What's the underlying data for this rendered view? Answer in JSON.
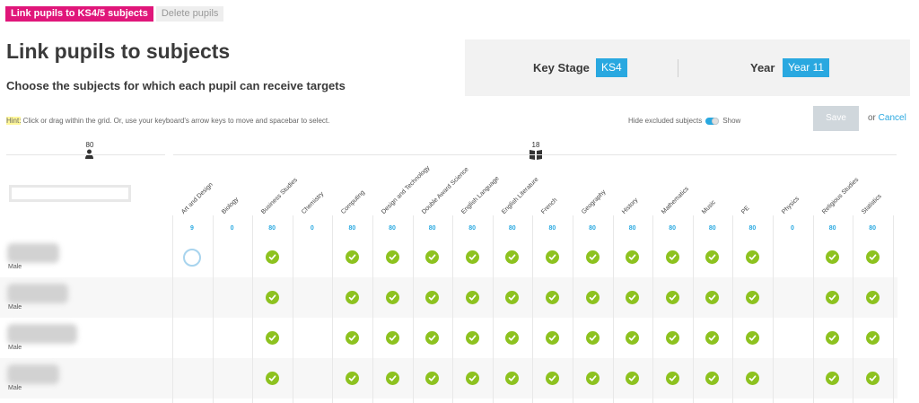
{
  "tabs": [
    {
      "label": "Link pupils to KS4/5 subjects",
      "active": true
    },
    {
      "label": "Delete pupils",
      "active": false
    }
  ],
  "title": "Link pupils to subjects",
  "subtitle": "Choose the subjects for which each pupil can receive targets",
  "context": {
    "key_stage_label": "Key Stage",
    "key_stage_value": "KS4",
    "year_label": "Year",
    "year_value": "Year 11"
  },
  "hint": {
    "tag": "Hint:",
    "text": " Click or drag within the grid. Or, use your keyboard's arrow keys to move and spacebar to select."
  },
  "toggle": {
    "left_label": "Hide excluded subjects",
    "right_label": "Show"
  },
  "actions": {
    "save_label": "Save",
    "or_label": "or ",
    "cancel_label": "Cancel"
  },
  "counts": {
    "pupils": "80",
    "subjects": "18"
  },
  "search": {
    "placeholder": ""
  },
  "colors": {
    "accent": "#29a8e0",
    "tab_active": "#e0167a",
    "check": "#8dc21f"
  },
  "subjects": [
    {
      "name": "Art and Design",
      "count": "9"
    },
    {
      "name": "Biology",
      "count": "0"
    },
    {
      "name": "Business Studies",
      "count": "80"
    },
    {
      "name": "Chemistry",
      "count": "0"
    },
    {
      "name": "Computing",
      "count": "80"
    },
    {
      "name": "Design and Technology",
      "count": "80"
    },
    {
      "name": "Double Award Science",
      "count": "80"
    },
    {
      "name": "English Language",
      "count": "80"
    },
    {
      "name": "English Literature",
      "count": "80"
    },
    {
      "name": "French",
      "count": "80"
    },
    {
      "name": "Geography",
      "count": "80"
    },
    {
      "name": "History",
      "count": "80"
    },
    {
      "name": "Mathematics",
      "count": "80"
    },
    {
      "name": "Music",
      "count": "80"
    },
    {
      "name": "PE",
      "count": "80"
    },
    {
      "name": "Physics",
      "count": "0"
    },
    {
      "name": "Religious Studies",
      "count": "80"
    },
    {
      "name": "Statistics",
      "count": "80"
    }
  ],
  "pupils": [
    {
      "gender": "Male",
      "links": [
        "empty",
        "none",
        "check",
        "none",
        "check",
        "check",
        "check",
        "check",
        "check",
        "check",
        "check",
        "check",
        "check",
        "check",
        "check",
        "none",
        "check",
        "check"
      ]
    },
    {
      "gender": "Male",
      "links": [
        "none",
        "none",
        "check",
        "none",
        "check",
        "check",
        "check",
        "check",
        "check",
        "check",
        "check",
        "check",
        "check",
        "check",
        "check",
        "none",
        "check",
        "check"
      ]
    },
    {
      "gender": "Male",
      "links": [
        "none",
        "none",
        "check",
        "none",
        "check",
        "check",
        "check",
        "check",
        "check",
        "check",
        "check",
        "check",
        "check",
        "check",
        "check",
        "none",
        "check",
        "check"
      ]
    },
    {
      "gender": "Male",
      "links": [
        "none",
        "none",
        "check",
        "none",
        "check",
        "check",
        "check",
        "check",
        "check",
        "check",
        "check",
        "check",
        "check",
        "check",
        "check",
        "none",
        "check",
        "check"
      ]
    }
  ]
}
